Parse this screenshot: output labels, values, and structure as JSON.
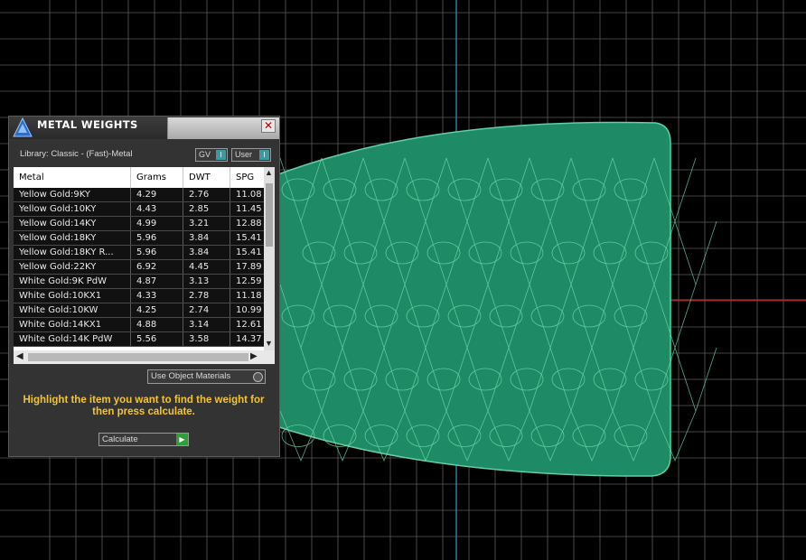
{
  "panel": {
    "title": "METAL WEIGHTS",
    "close_icon": "close-icon",
    "library_label": "Library: Classic - (Fast)-Metal",
    "gv_label": "GV",
    "user_label": "User",
    "toggle_indicator": "I",
    "table": {
      "headers": [
        "Metal",
        "Grams",
        "DWT",
        "SPG"
      ],
      "rows": [
        [
          "Yellow Gold:9KY",
          "4.29",
          "2.76",
          "11.08"
        ],
        [
          "Yellow Gold:10KY",
          "4.43",
          "2.85",
          "11.45"
        ],
        [
          "Yellow Gold:14KY",
          "4.99",
          "3.21",
          "12.88"
        ],
        [
          "Yellow Gold:18KY",
          "5.96",
          "3.84",
          "15.41"
        ],
        [
          "Yellow Gold:18KY R...",
          "5.96",
          "3.84",
          "15.41"
        ],
        [
          "Yellow Gold:22KY",
          "6.92",
          "4.45",
          "17.89"
        ],
        [
          "White Gold:9K PdW",
          "4.87",
          "3.13",
          "12.59"
        ],
        [
          "White Gold:10KX1",
          "4.33",
          "2.78",
          "11.18"
        ],
        [
          "White Gold:10KW",
          "4.25",
          "2.74",
          "10.99"
        ],
        [
          "White Gold:14KX1",
          "4.88",
          "3.14",
          "12.61"
        ],
        [
          "White Gold:14K PdW",
          "5.56",
          "3.58",
          "14.37"
        ]
      ]
    },
    "use_object_materials": "Use Object Materials",
    "hint": "Highlight the item you want to find the weight for then press calculate.",
    "calculate_label": "Calculate"
  },
  "colors": {
    "mesh": "#1f8a66",
    "mesh_line": "#5fd0a3",
    "grid": "#5a5a5a",
    "hint": "#f4c430"
  }
}
